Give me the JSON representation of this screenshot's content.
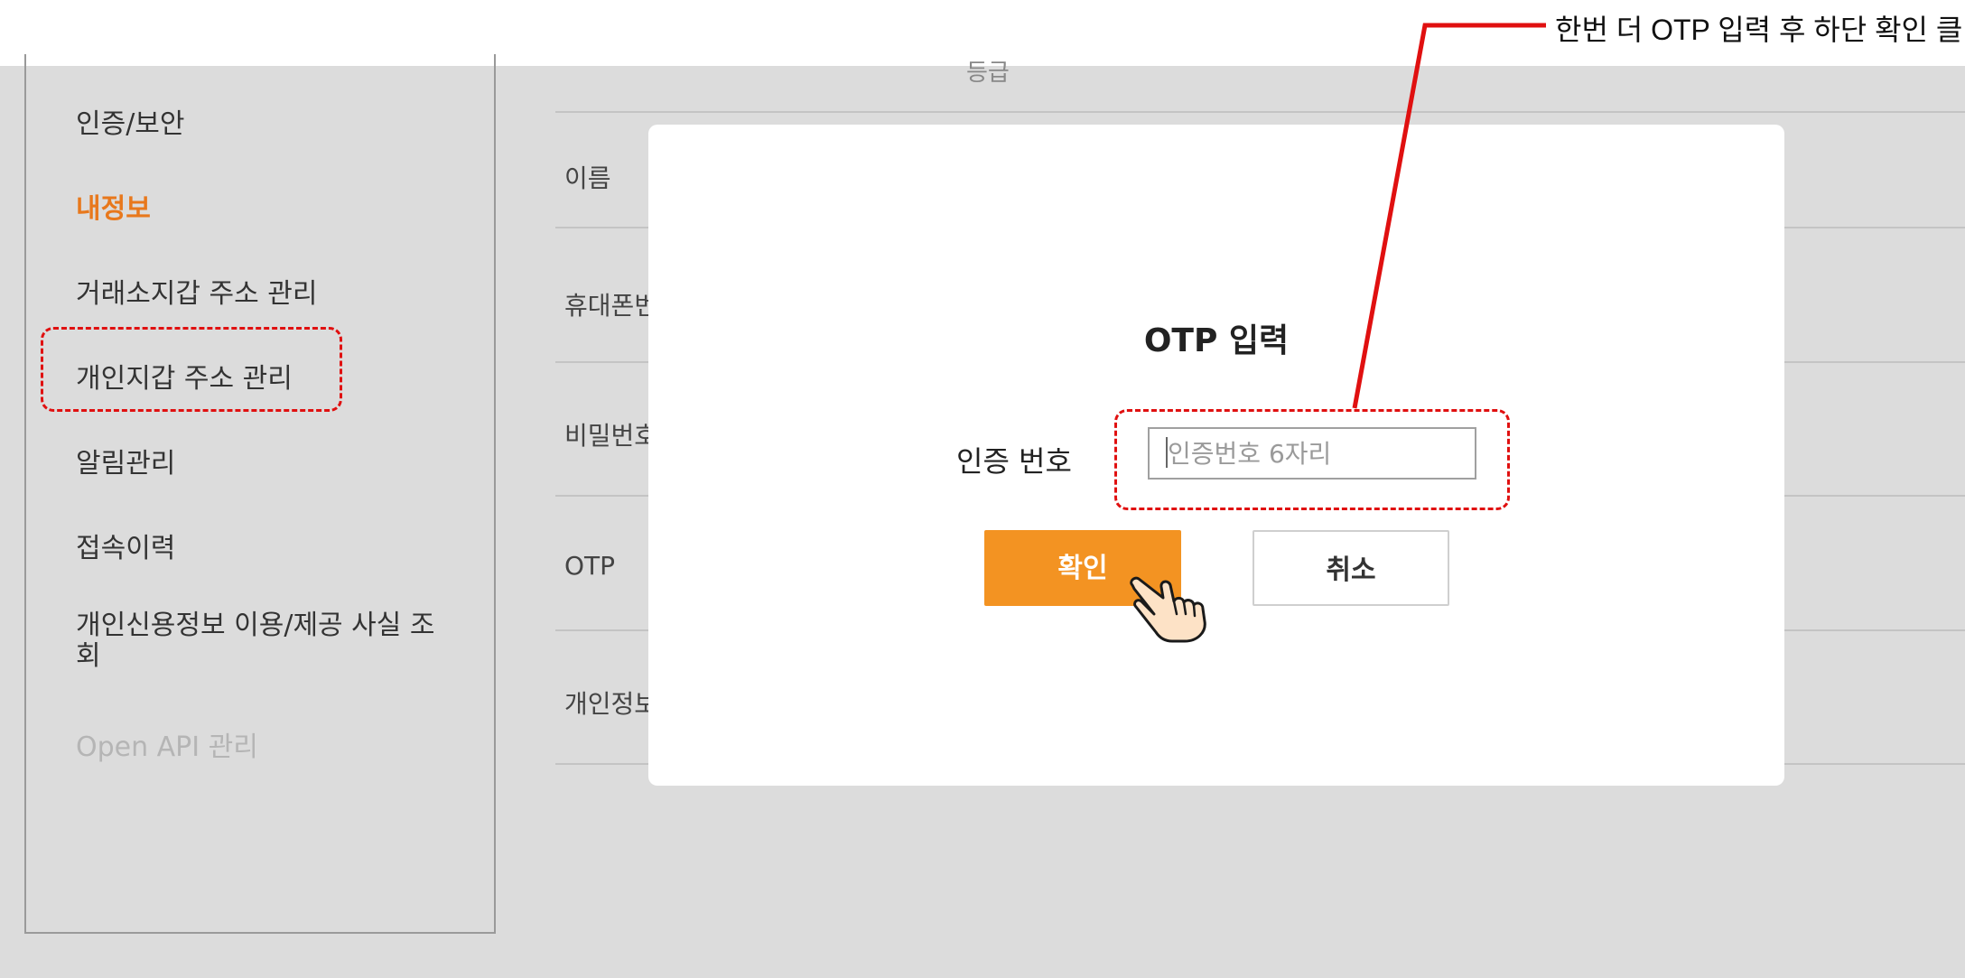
{
  "sidebar": {
    "items": [
      {
        "label": "인증/보안",
        "state": "normal"
      },
      {
        "label": "내정보",
        "state": "active"
      },
      {
        "label": "거래소지갑 주소 관리",
        "state": "normal"
      },
      {
        "label": "개인지갑 주소 관리",
        "state": "highlighted"
      },
      {
        "label": "알림관리",
        "state": "normal"
      },
      {
        "label": "접속이력",
        "state": "normal"
      },
      {
        "label": "개인신용정보 이용/제공 사실 조회",
        "state": "normal"
      },
      {
        "label": "Open API 관리",
        "state": "disabled"
      }
    ]
  },
  "background_rows": {
    "top_fragment": "등급",
    "labels": [
      "이름",
      "휴대폰번",
      "비밀번호",
      "OTP",
      "개인정보"
    ]
  },
  "modal": {
    "title": "OTP 입력",
    "field_label": "인증 번호",
    "input": {
      "value": "",
      "placeholder": "인증번호 6자리"
    },
    "confirm_label": "확인",
    "cancel_label": "취소"
  },
  "annotation": {
    "text": "한번 더 OTP 입력 후 하단 확인 클릭"
  },
  "colors": {
    "accent": "#f39322",
    "active_menu": "#e8781c",
    "annotation_red": "#e01010",
    "overlay": "#dcdcdc"
  },
  "icons": {
    "pointer": "hand-pointer-icon"
  }
}
